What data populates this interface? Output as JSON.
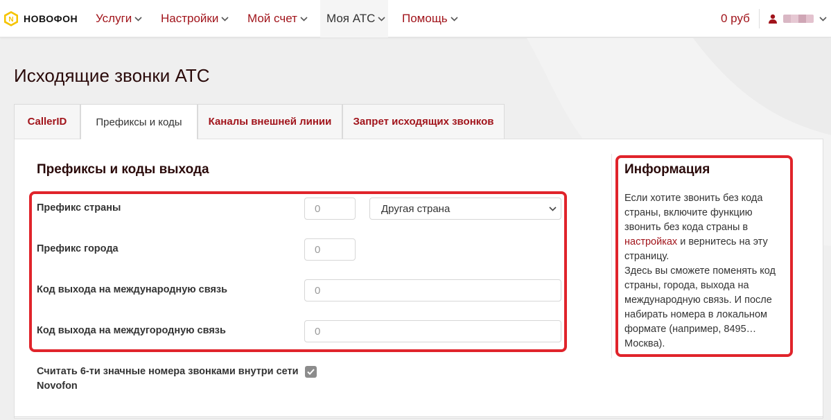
{
  "nav": {
    "logo_text": "НОВОФОН",
    "items": [
      {
        "label": "Услуги"
      },
      {
        "label": "Настройки"
      },
      {
        "label": "Мой счет"
      },
      {
        "label": "Моя АТС"
      },
      {
        "label": "Помощь"
      }
    ],
    "balance": "0 руб",
    "accent_color": "#a1141b"
  },
  "page": {
    "title": "Исходящие звонки АТС"
  },
  "tabs": [
    {
      "label": "CallerID"
    },
    {
      "label": "Префиксы и коды"
    },
    {
      "label": "Каналы внешней линии"
    },
    {
      "label": "Запрет исходящих звонков"
    }
  ],
  "form": {
    "section_title": "Префиксы и коды выхода",
    "rows": [
      {
        "label": "Префикс страны",
        "value": "0"
      },
      {
        "label": "Префикс города",
        "value": "0"
      },
      {
        "label": "Код выхода на международную связь",
        "value": "0"
      },
      {
        "label": "Код выхода на междугородную связь",
        "value": "0"
      }
    ],
    "country_select": "Другая страна",
    "checkbox_label": "Считать 6-ти значные номера звонками внутри сети Novofon",
    "checkbox_checked": true,
    "highlight_color": "#e0242b"
  },
  "info": {
    "title": "Информация",
    "text_before_link": "Если хотите звонить без кода страны, включите функцию звонить без кода страны в ",
    "link": "настройках",
    "text_after_link": " и вернитесь на эту страницу.",
    "text_2": "Здесь вы сможете поменять код страны, города, выхода на международную связь. И после набирать номера в локальном формате (например, 8495… Москва)."
  }
}
